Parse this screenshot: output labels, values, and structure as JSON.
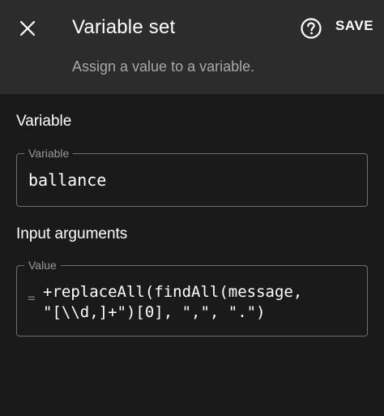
{
  "header": {
    "title": "Variable set",
    "subtitle": "Assign a value to a variable.",
    "save_label": "SAVE",
    "close_icon": "close-icon",
    "help_icon": "help-circle-icon"
  },
  "variable_section": {
    "heading": "Variable",
    "field_label": "Variable",
    "field_value": "ballance"
  },
  "arguments_section": {
    "heading": "Input arguments",
    "field_label": "Value",
    "prefix_symbol": "=",
    "field_value_line1": "+replaceAll(findAll(message,",
    "field_value_line2": "\"[\\\\d,]+\")[0], \",\", \".\")"
  },
  "colors": {
    "app_bar": "#2c2c2c",
    "background": "#1a1a1a",
    "subtitle_text": "#a8a8a8",
    "field_border": "#6e6e6e"
  }
}
